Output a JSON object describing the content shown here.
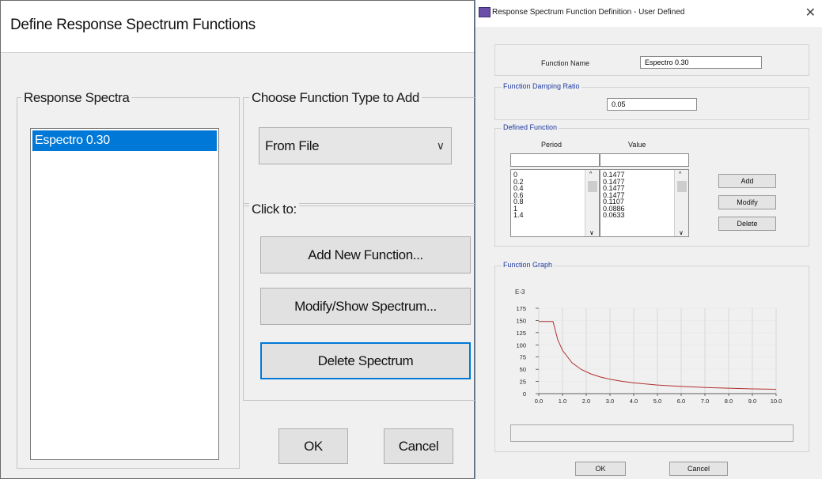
{
  "left_dialog": {
    "title": "Define Response Spectrum Functions",
    "response_spectra_label": "Response Spectra",
    "spectra": [
      "Espectro 0.30"
    ],
    "choose_type_label": "Choose  Function Type to Add",
    "function_type_value": "From File",
    "click_to_label": "Click to:",
    "add_button": "Add New Function...",
    "modify_button": "Modify/Show Spectrum...",
    "delete_button": "Delete Spectrum",
    "ok_button": "OK",
    "cancel_button": "Cancel"
  },
  "right_dialog": {
    "title": "Response Spectrum Function Definition - User Defined",
    "function_name_label": "Function Name",
    "function_name_value": "Espectro 0.30",
    "damping_group": "Function Damping Ratio",
    "damping_value": "0.05",
    "defined_group": "Defined Function",
    "period_header": "Period",
    "value_header": "Value",
    "periods": [
      "0",
      "0.2",
      "0.4",
      "0.6",
      "0.8",
      "1",
      "1.4"
    ],
    "values": [
      "0.1477",
      "0.1477",
      "0.1477",
      "0.1477",
      "0.1107",
      "0.0886",
      "0.0633"
    ],
    "add_button": "Add",
    "modify_button": "Modify",
    "delete_button": "Delete",
    "graph_group": "Function Graph",
    "ok_button": "OK",
    "cancel_button": "Cancel"
  },
  "chart_data": {
    "type": "line",
    "y_multiplier_label": "E-3",
    "x_ticks": [
      "0.0",
      "1.0",
      "2.0",
      "3.0",
      "4.0",
      "5.0",
      "6.0",
      "7.0",
      "8.0",
      "9.0",
      "10.0"
    ],
    "y_ticks": [
      "0",
      "25",
      "50",
      "75",
      "100",
      "125",
      "150",
      "175"
    ],
    "xlim": [
      0,
      10
    ],
    "ylim": [
      0,
      175
    ],
    "grid": true,
    "line_color": "#b03030",
    "series": [
      {
        "x": [
          0,
          0.2,
          0.4,
          0.6,
          0.8,
          1.0,
          1.4,
          1.8,
          2.2,
          2.6,
          3.0,
          3.5,
          4.0,
          4.5,
          5.0,
          6.0,
          7.0,
          8.0,
          9.0,
          10.0
        ],
        "y": [
          147.7,
          147.7,
          147.7,
          147.7,
          110.7,
          88.6,
          63.3,
          49.2,
          40.3,
          34.1,
          29.5,
          25.3,
          22.1,
          19.7,
          17.7,
          14.8,
          12.7,
          11.1,
          9.8,
          8.9
        ]
      }
    ]
  }
}
